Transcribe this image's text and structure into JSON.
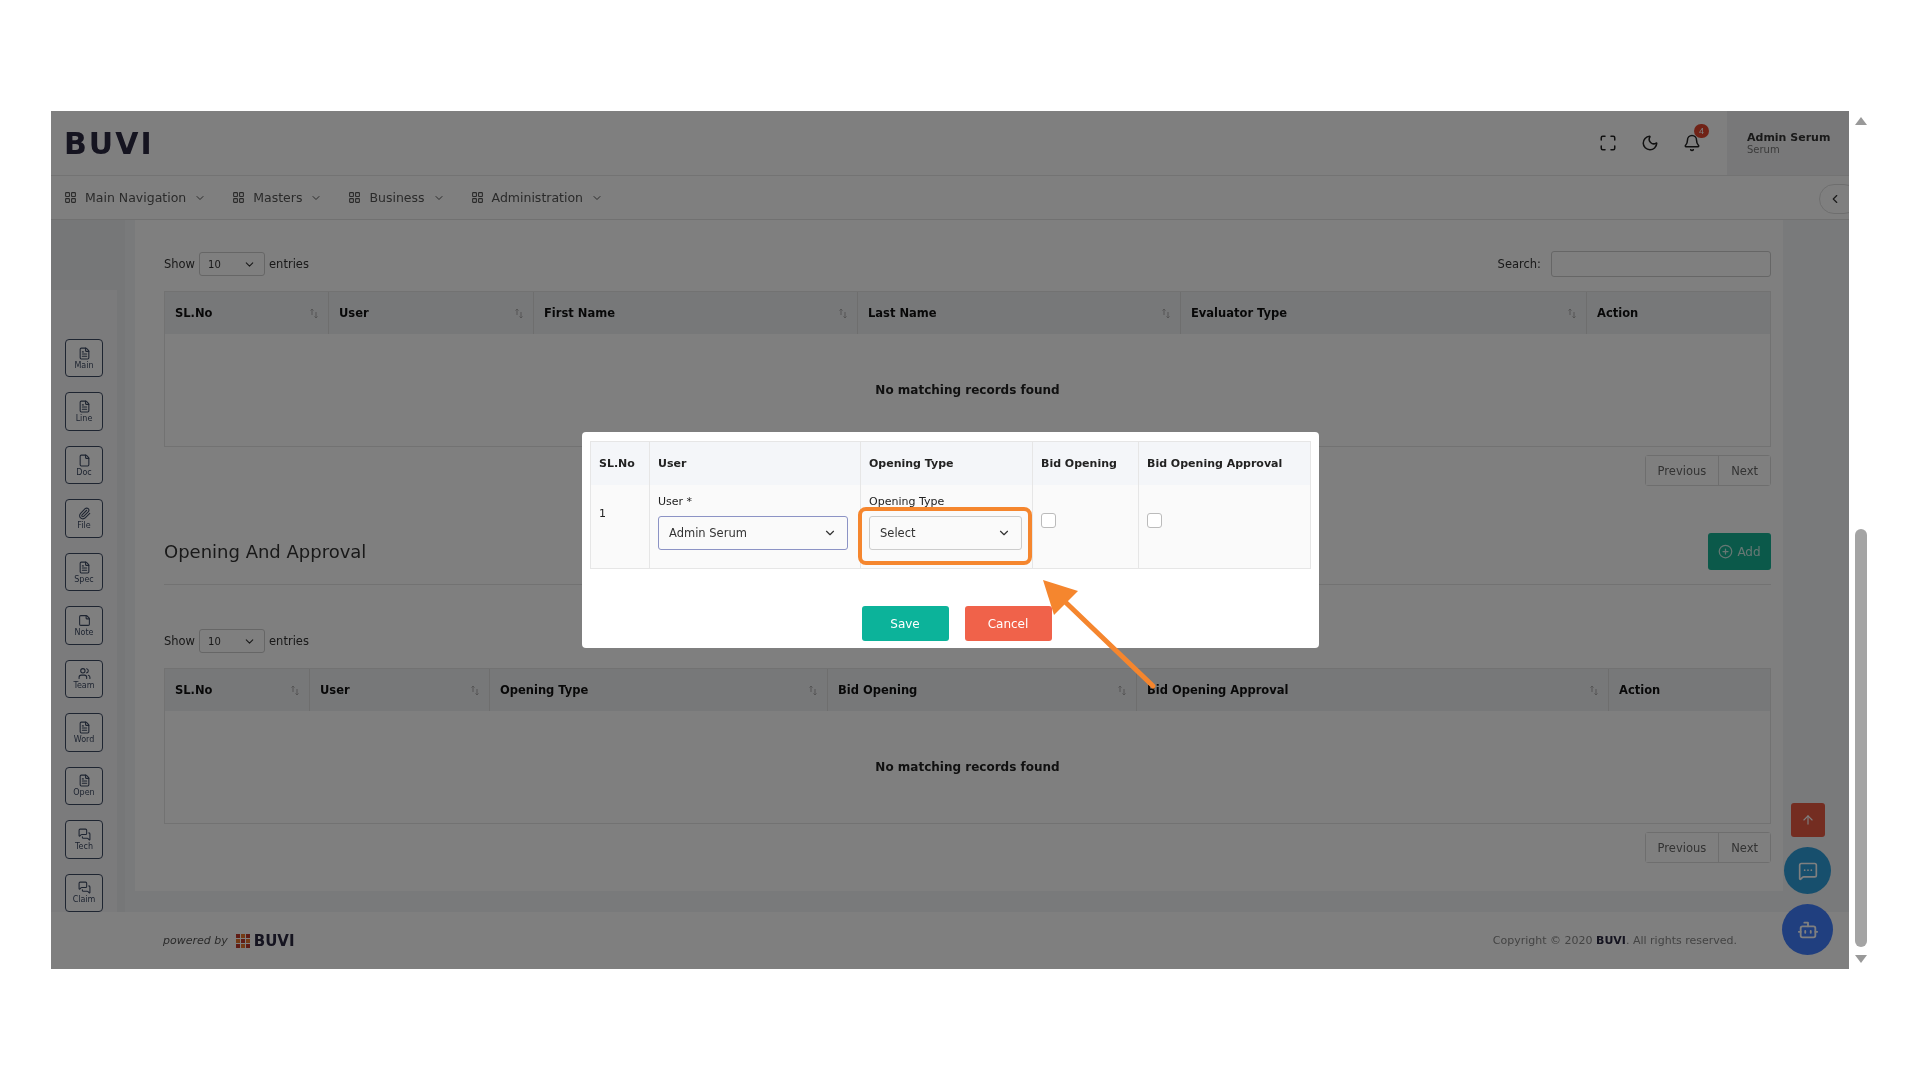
{
  "header": {
    "logo": "BUVI",
    "notification_count": "4",
    "user": {
      "name": "Admin Serum",
      "role": "Serum"
    }
  },
  "nav": [
    {
      "label": "Main Navigation"
    },
    {
      "label": "Masters"
    },
    {
      "label": "Business"
    },
    {
      "label": "Administration"
    }
  ],
  "sidebar": [
    {
      "label": "Main",
      "kind": "list"
    },
    {
      "label": "Line",
      "kind": "list"
    },
    {
      "label": "Doc",
      "kind": "page"
    },
    {
      "label": "File",
      "kind": "clip"
    },
    {
      "label": "Spec",
      "kind": "list"
    },
    {
      "label": "Note",
      "kind": "note"
    },
    {
      "label": "Team",
      "kind": "team"
    },
    {
      "label": "Word",
      "kind": "list"
    },
    {
      "label": "Open",
      "kind": "list"
    },
    {
      "label": "Tech",
      "kind": "chat"
    },
    {
      "label": "Claim",
      "kind": "chat"
    }
  ],
  "evaluator_table": {
    "show_label": "Show",
    "page_size": "10",
    "entries_label": "entries",
    "search_label": "Search:",
    "columns": [
      {
        "label": "SL.No",
        "sortable": true
      },
      {
        "label": "User",
        "sortable": true
      },
      {
        "label": "First Name",
        "sortable": true
      },
      {
        "label": "Last Name",
        "sortable": true
      },
      {
        "label": "Evaluator Type",
        "sortable": true
      },
      {
        "label": "Action",
        "sortable": false
      }
    ],
    "empty_message": "No matching records found",
    "pagination": [
      "Previous",
      "Next"
    ]
  },
  "opening_section": {
    "title": "Opening And Approval",
    "add_button": "Add",
    "table": {
      "show_label": "Show",
      "page_size": "10",
      "entries_label": "entries",
      "columns": [
        {
          "label": "SL.No",
          "sortable": true
        },
        {
          "label": "User",
          "sortable": true
        },
        {
          "label": "Opening Type",
          "sortable": true
        },
        {
          "label": "Bid Opening",
          "sortable": true
        },
        {
          "label": "Bid Opening Approval",
          "sortable": true
        },
        {
          "label": "Action",
          "sortable": false
        }
      ],
      "empty_message": "No matching records found",
      "pagination": [
        "Previous",
        "Next"
      ]
    }
  },
  "modal": {
    "columns": [
      "SL.No",
      "User",
      "Opening Type",
      "Bid Opening",
      "Bid Opening Approval"
    ],
    "rows": [
      {
        "sl_no": "1",
        "user_label": "User *",
        "user_value": "Admin Serum",
        "opening_type_label": "Opening Type",
        "opening_type_value": "Select",
        "bid_opening": false,
        "bid_opening_approval": false
      }
    ],
    "buttons": [
      {
        "label": "Save",
        "kind": "primary"
      },
      {
        "label": "Cancel",
        "kind": "danger"
      }
    ]
  },
  "footer": {
    "powered_by": "powered by",
    "brand": "BUVI",
    "copyright": "Copyright © 2020 **BUVI**. All rights reserved."
  }
}
